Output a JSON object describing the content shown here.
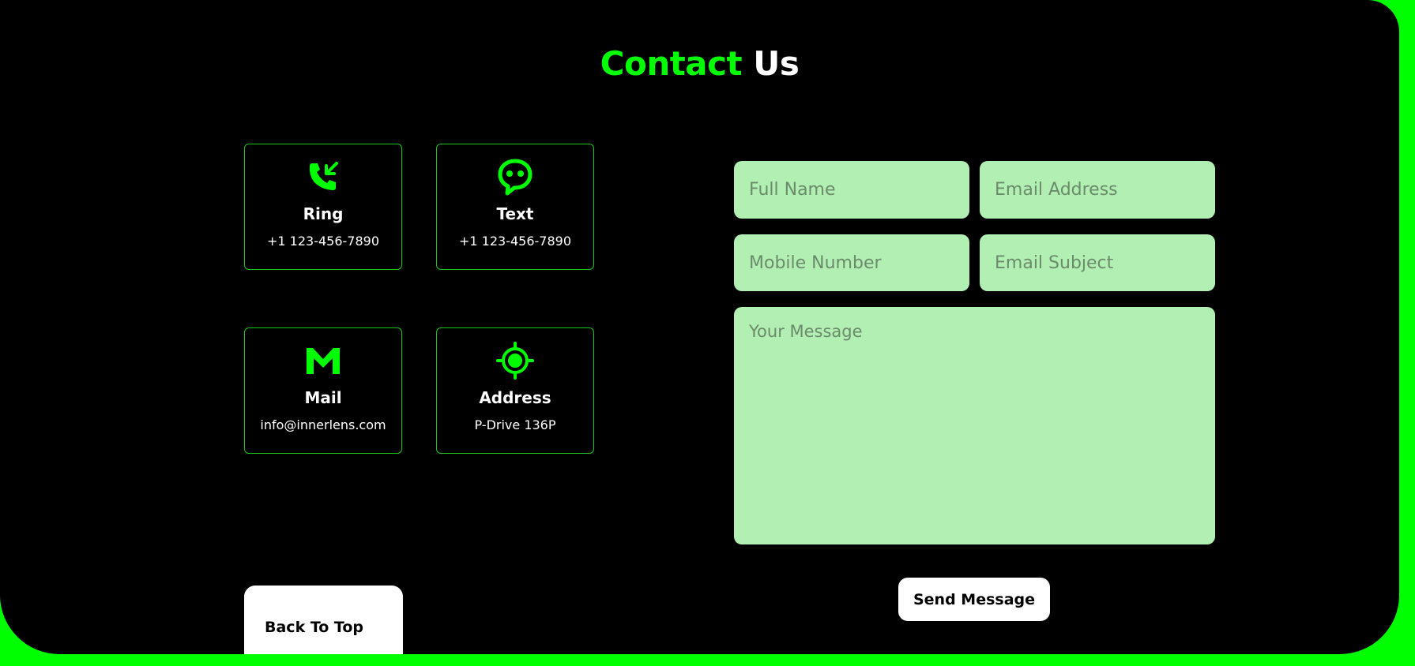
{
  "heading": {
    "accent": "Contact",
    "rest": "Us"
  },
  "cards": [
    {
      "label": "Ring",
      "value": "+1 123-456-7890",
      "icon": "phone-incoming-icon"
    },
    {
      "label": "Text",
      "value": "+1 123-456-7890",
      "icon": "chat-bubble-icon"
    },
    {
      "label": "Mail",
      "value": "info@innerlens.com",
      "icon": "mail-icon"
    },
    {
      "label": "Address",
      "value": "P-Drive 136P",
      "icon": "location-target-icon"
    }
  ],
  "form": {
    "full_name_placeholder": "Full Name",
    "email_placeholder": "Email Address",
    "mobile_placeholder": "Mobile Number",
    "subject_placeholder": "Email Subject",
    "message_placeholder": "Your Message",
    "send_label": "Send Message"
  },
  "back_to_top_label": "Back To Top",
  "colors": {
    "accent": "#00ff00",
    "background": "#000000",
    "field": "#b2efb2"
  }
}
